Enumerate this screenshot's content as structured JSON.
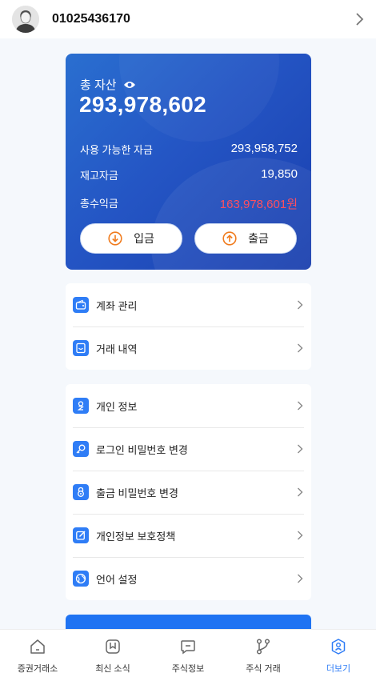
{
  "header": {
    "username": "01025436170",
    "avatar_icon": "user-avatar-icon",
    "chevron_icon": "chevron-right-icon"
  },
  "asset_card": {
    "title": "총 자산",
    "total": "293,978,602",
    "rows": [
      {
        "label": "사용 가능한 자금",
        "value": "293,958,752"
      },
      {
        "label": "재고자금",
        "value": "19,850"
      },
      {
        "label": "총수익금",
        "value": "163,978,601원"
      }
    ],
    "deposit_label": "입금",
    "withdraw_label": "출금",
    "profit_color": "#ff4f5e"
  },
  "menu_group_1": [
    {
      "label": "계좌 관리",
      "icon": "wallet-icon"
    },
    {
      "label": "거래 내역",
      "icon": "receipt-icon"
    }
  ],
  "menu_group_2": [
    {
      "label": "개인 정보",
      "icon": "person-icon"
    },
    {
      "label": "로그인 비밀번호 변경",
      "icon": "key-icon"
    },
    {
      "label": "출금 비밀번호 변경",
      "icon": "lock-icon"
    },
    {
      "label": "개인정보 보호정책",
      "icon": "edit-icon"
    },
    {
      "label": "언어 설정",
      "icon": "globe-icon"
    }
  ],
  "tabbar": [
    {
      "label": "증권거래소",
      "icon": "home-icon"
    },
    {
      "label": "최신 소식",
      "icon": "bookmark-icon"
    },
    {
      "label": "주식정보",
      "icon": "message-icon"
    },
    {
      "label": "주식 거래",
      "icon": "branch-icon"
    },
    {
      "label": "더보기",
      "icon": "profile-icon"
    }
  ],
  "colors": {
    "accent": "#2f7df6",
    "card_start": "#2a6fd0",
    "card_end": "#1a3fae"
  }
}
